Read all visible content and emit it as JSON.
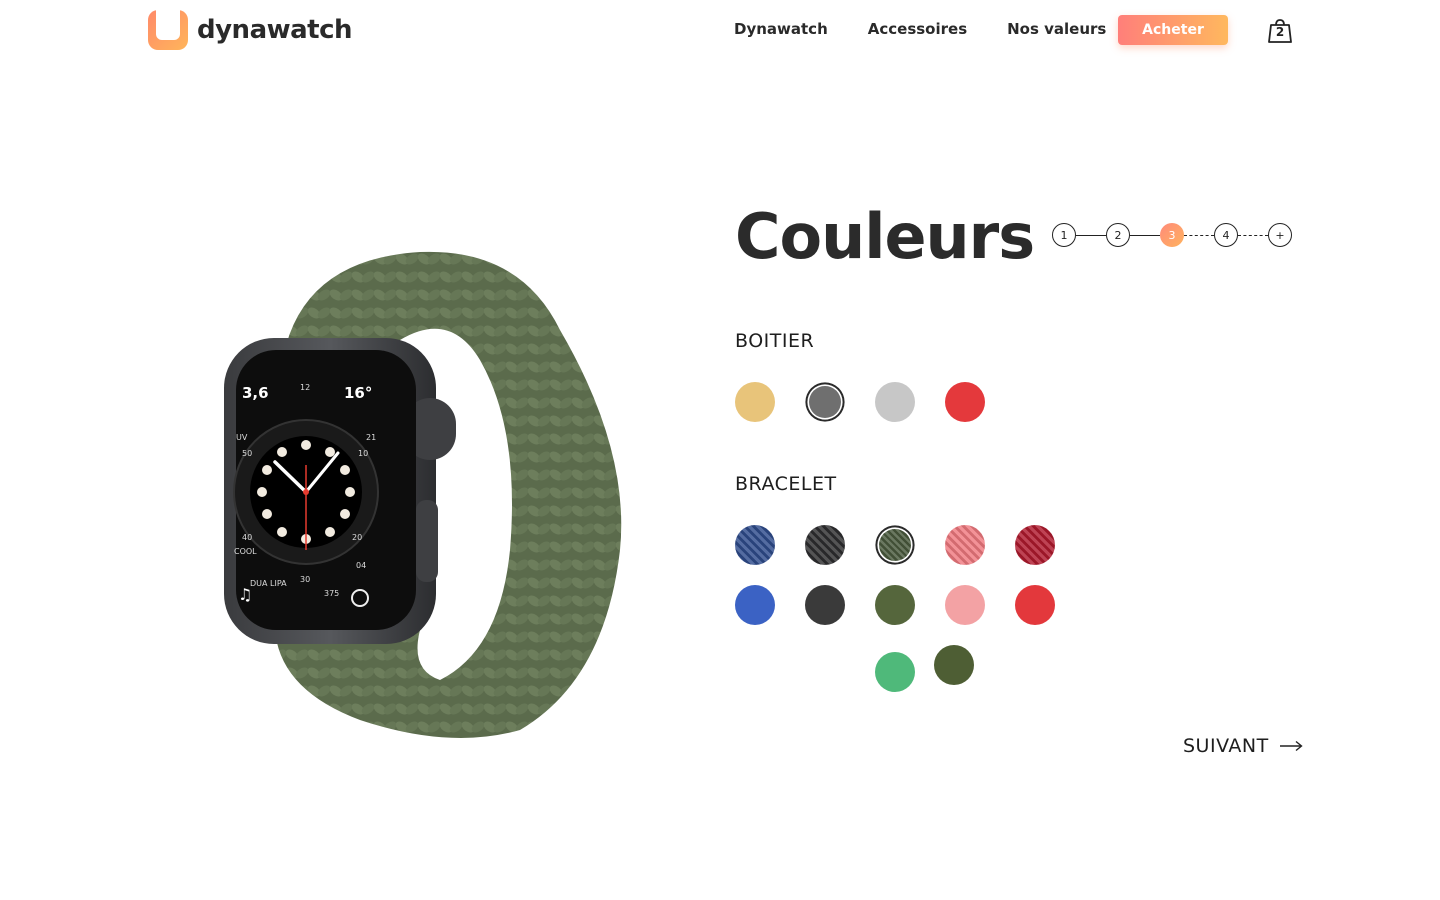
{
  "brand": {
    "name": "dynawatch",
    "gradient": [
      "#ff8a6a",
      "#ffb55a"
    ]
  },
  "nav": {
    "items": [
      "Dynawatch",
      "Accessoires",
      "Nos valeurs"
    ],
    "buy_label": "Acheter",
    "cart_count": "2"
  },
  "main": {
    "title": "Couleurs",
    "steps": [
      {
        "label": "1",
        "state": "done"
      },
      {
        "label": "2",
        "state": "done"
      },
      {
        "label": "3",
        "state": "active"
      },
      {
        "label": "4",
        "state": "todo"
      },
      {
        "label": "+",
        "state": "todo"
      }
    ],
    "case": {
      "label": "BOITIER",
      "options": [
        {
          "color": "#e8c47a",
          "selected": false
        },
        {
          "color": "#6f6f6f",
          "selected": true
        },
        {
          "color": "#c7c7c7",
          "selected": false
        },
        {
          "color": "#e4393c",
          "selected": false
        }
      ]
    },
    "band": {
      "label": "BRACELET",
      "options": [
        {
          "color": "#2f4c8c",
          "texture": "braided",
          "selected": false
        },
        {
          "color": "#2e2e30",
          "texture": "braided",
          "selected": false
        },
        {
          "color": "#4a5a3e",
          "texture": "braided",
          "selected": true
        },
        {
          "color": "#f07a80",
          "texture": "braided",
          "selected": false
        },
        {
          "color": "#b01a2e",
          "texture": "braided",
          "selected": false
        },
        {
          "color": "#3b62c4",
          "texture": "solid",
          "selected": false
        },
        {
          "color": "#3a3a3a",
          "texture": "solid",
          "selected": false
        },
        {
          "color": "#55663c",
          "texture": "solid",
          "selected": false
        },
        {
          "color": "#f3a2a4",
          "texture": "solid",
          "selected": false
        },
        {
          "color": "#e3383c",
          "texture": "solid",
          "selected": false
        },
        {
          "color": "#4fb97a",
          "texture": "solid",
          "selected": false
        },
        {
          "color": "#4e5e34",
          "texture": "solid",
          "selected": false
        }
      ]
    },
    "next_label": "SUIVANT"
  },
  "watch_face": {
    "complications": [
      "3,6",
      "16°",
      "UV",
      "21",
      "50",
      "10",
      "40",
      "20",
      "30",
      "375",
      "04",
      "12",
      "COOL",
      "DUA LIPA"
    ]
  }
}
